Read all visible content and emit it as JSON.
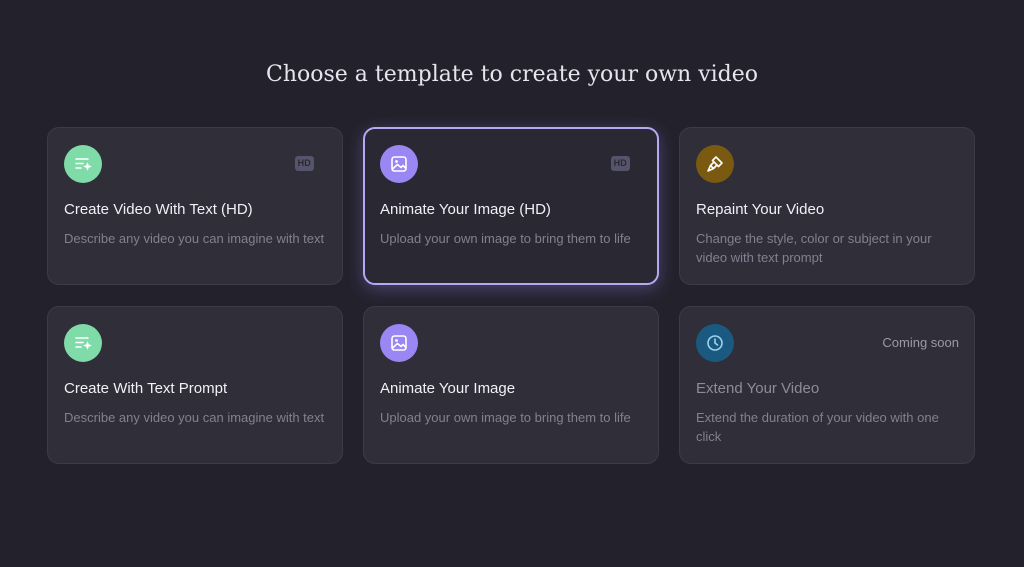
{
  "page": {
    "title": "Choose a template to create your own video"
  },
  "colors": {
    "background": "#23222c",
    "card": "#2f2e39",
    "selected_border": "#b7a8f4",
    "icon_green": "#7fdca8",
    "icon_purple": "#9a87f3",
    "icon_gold": "#7a5a10",
    "icon_teal": "#1a5a80"
  },
  "templates": [
    {
      "icon": "text-sparkle-icon",
      "title": "Create Video With Text (HD)",
      "description": "Describe any video you can imagine with text",
      "badge": "HD",
      "selected": false
    },
    {
      "icon": "image-icon",
      "title": "Animate Your Image (HD)",
      "description": "Upload your own image to bring them to life",
      "badge": "HD",
      "selected": true
    },
    {
      "icon": "brush-icon",
      "title": "Repaint Your Video",
      "description": "Change the style, color or subject in your video with text prompt",
      "badge": "",
      "selected": false
    },
    {
      "icon": "text-sparkle-icon",
      "title": "Create With Text Prompt",
      "description": "Describe any video you can imagine with text",
      "badge": "",
      "selected": false
    },
    {
      "icon": "image-icon",
      "title": "Animate Your Image",
      "description": "Upload your own image to bring them to life",
      "badge": "",
      "selected": false
    },
    {
      "icon": "clock-icon",
      "title": "Extend Your Video",
      "description": "Extend the duration of your video with one click",
      "badge": "Coming soon",
      "selected": false
    }
  ]
}
